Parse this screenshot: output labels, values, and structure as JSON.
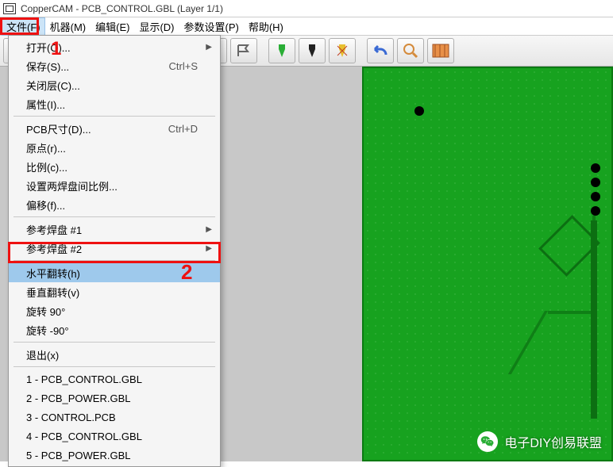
{
  "title": "CopperCAM  -  PCB_CONTROL.GBL   (Layer 1/1)",
  "menubar": [
    {
      "label": "文件(F)",
      "active": true
    },
    {
      "label": "机器(M)"
    },
    {
      "label": "编辑(E)"
    },
    {
      "label": "显示(D)"
    },
    {
      "label": "参数设置(P)"
    },
    {
      "label": "帮助(H)"
    }
  ],
  "marker1_number": "1",
  "marker2_number": "2",
  "dropdown": [
    {
      "label": "打开(O)...",
      "submenu": true
    },
    {
      "label": "保存(S)...",
      "shortcut": "Ctrl+S"
    },
    {
      "label": "关闭层(C)..."
    },
    {
      "label": "属性(I)..."
    },
    {
      "sep": true
    },
    {
      "label": "PCB尺寸(D)...",
      "shortcut": "Ctrl+D"
    },
    {
      "label": "原点(r)..."
    },
    {
      "label": "比例(c)..."
    },
    {
      "label": "设置两焊盘间比例..."
    },
    {
      "label": "偏移(f)..."
    },
    {
      "sep": true
    },
    {
      "label": "参考焊盘 #1",
      "submenu": true
    },
    {
      "label": "参考焊盘 #2",
      "submenu": true
    },
    {
      "sep": true
    },
    {
      "label": "水平翻转(h)",
      "highlight": true
    },
    {
      "label": "垂直翻转(v)"
    },
    {
      "label": "旋转 90°"
    },
    {
      "label": "旋转 -90°"
    },
    {
      "sep": true
    },
    {
      "label": "退出(x)"
    },
    {
      "sep": true
    },
    {
      "label": "1 - PCB_CONTROL.GBL"
    },
    {
      "label": "2 - PCB_POWER.GBL"
    },
    {
      "label": "3 - CONTROL.PCB"
    },
    {
      "label": "4 - PCB_CONTROL.GBL"
    },
    {
      "label": "5 - PCB_POWER.GBL"
    }
  ],
  "toolbar_icons": [
    "folder-open-icon",
    "save-icon",
    "layers-icon",
    "layer-single-icon",
    "sep",
    "pin-icon",
    "pin-outline-icon",
    "sep",
    "flag-green-icon",
    "flag-outline-icon",
    "sep",
    "drill-green-icon",
    "drill-black-icon",
    "drill-yellow-icon",
    "sep",
    "undo-icon",
    "zoom-icon",
    "board-icon"
  ],
  "watermark": "电子DIY创易联盟"
}
